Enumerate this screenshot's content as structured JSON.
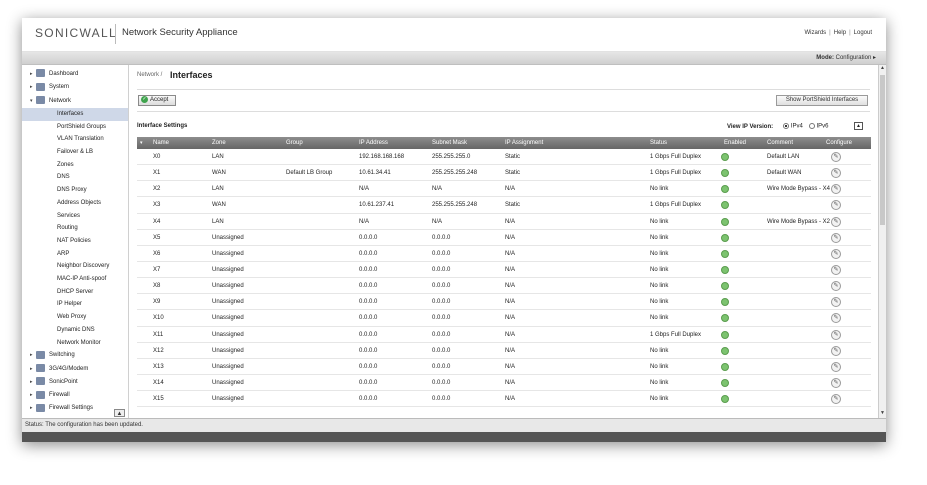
{
  "header": {
    "logo": "SONICWALL",
    "app_name": "Network Security Appliance",
    "links": [
      "Wizards",
      "Help",
      "Logout"
    ]
  },
  "modebar": {
    "mode_label": "Mode:",
    "mode_value": "Configuration ▸"
  },
  "sidebar": {
    "top_items": [
      {
        "label": "Dashboard",
        "arrow": "▸"
      },
      {
        "label": "System",
        "arrow": "▸"
      },
      {
        "label": "Network",
        "arrow": "▾"
      }
    ],
    "network_items": [
      "Interfaces",
      "PortShield Groups",
      "VLAN Translation",
      "Failover & LB",
      "Zones",
      "DNS",
      "DNS Proxy",
      "Address Objects",
      "Services",
      "Routing",
      "NAT Policies",
      "ARP",
      "Neighbor Discovery",
      "MAC-IP Anti-spoof",
      "DHCP Server",
      "IP Helper",
      "Web Proxy",
      "Dynamic DNS",
      "Network Monitor"
    ],
    "bottom_items": [
      {
        "label": "Switching",
        "arrow": "▸"
      },
      {
        "label": "3G/4G/Modem",
        "arrow": "▸"
      },
      {
        "label": "SonicPoint",
        "arrow": "▸"
      },
      {
        "label": "Firewall",
        "arrow": "▸"
      },
      {
        "label": "Firewall Settings",
        "arrow": "▸"
      }
    ]
  },
  "main": {
    "breadcrumb": "Network /",
    "title": "Interfaces",
    "accept_label": "Accept",
    "portshield_label": "Show PortShield Interfaces",
    "settings_title": "Interface Settings",
    "ip_version_label": "View IP Version:",
    "ipv4_label": "IPv4",
    "ipv6_label": "IPv6"
  },
  "table": {
    "columns": [
      "Name",
      "Zone",
      "Group",
      "IP Address",
      "Subnet Mask",
      "IP Assignment",
      "Status",
      "Enabled",
      "Comment",
      "Configure"
    ],
    "rows": [
      {
        "name": "X0",
        "zone": "LAN",
        "group": "",
        "ip": "192.168.168.168",
        "mask": "255.255.255.0",
        "assign": "Static",
        "status": "1 Gbps Full Duplex",
        "comment": "Default LAN"
      },
      {
        "name": "X1",
        "zone": "WAN",
        "group": "Default LB Group",
        "ip": "10.61.34.41",
        "mask": "255.255.255.248",
        "assign": "Static",
        "status": "1 Gbps Full Duplex",
        "comment": "Default WAN"
      },
      {
        "name": "X2",
        "zone": "LAN",
        "group": "",
        "ip": "N/A",
        "mask": "N/A",
        "assign": "N/A",
        "status": "No link",
        "comment": "Wire Mode Bypass - X4"
      },
      {
        "name": "X3",
        "zone": "WAN",
        "group": "",
        "ip": "10.61.237.41",
        "mask": "255.255.255.248",
        "assign": "Static",
        "status": "1 Gbps Full Duplex",
        "comment": ""
      },
      {
        "name": "X4",
        "zone": "LAN",
        "group": "",
        "ip": "N/A",
        "mask": "N/A",
        "assign": "N/A",
        "status": "No link",
        "comment": "Wire Mode Bypass - X2"
      },
      {
        "name": "X5",
        "zone": "Unassigned",
        "group": "",
        "ip": "0.0.0.0",
        "mask": "0.0.0.0",
        "assign": "N/A",
        "status": "No link",
        "comment": ""
      },
      {
        "name": "X6",
        "zone": "Unassigned",
        "group": "",
        "ip": "0.0.0.0",
        "mask": "0.0.0.0",
        "assign": "N/A",
        "status": "No link",
        "comment": ""
      },
      {
        "name": "X7",
        "zone": "Unassigned",
        "group": "",
        "ip": "0.0.0.0",
        "mask": "0.0.0.0",
        "assign": "N/A",
        "status": "No link",
        "comment": ""
      },
      {
        "name": "X8",
        "zone": "Unassigned",
        "group": "",
        "ip": "0.0.0.0",
        "mask": "0.0.0.0",
        "assign": "N/A",
        "status": "No link",
        "comment": ""
      },
      {
        "name": "X9",
        "zone": "Unassigned",
        "group": "",
        "ip": "0.0.0.0",
        "mask": "0.0.0.0",
        "assign": "N/A",
        "status": "No link",
        "comment": ""
      },
      {
        "name": "X10",
        "zone": "Unassigned",
        "group": "",
        "ip": "0.0.0.0",
        "mask": "0.0.0.0",
        "assign": "N/A",
        "status": "No link",
        "comment": ""
      },
      {
        "name": "X11",
        "zone": "Unassigned",
        "group": "",
        "ip": "0.0.0.0",
        "mask": "0.0.0.0",
        "assign": "N/A",
        "status": "1 Gbps Full Duplex",
        "comment": ""
      },
      {
        "name": "X12",
        "zone": "Unassigned",
        "group": "",
        "ip": "0.0.0.0",
        "mask": "0.0.0.0",
        "assign": "N/A",
        "status": "No link",
        "comment": ""
      },
      {
        "name": "X13",
        "zone": "Unassigned",
        "group": "",
        "ip": "0.0.0.0",
        "mask": "0.0.0.0",
        "assign": "N/A",
        "status": "No link",
        "comment": ""
      },
      {
        "name": "X14",
        "zone": "Unassigned",
        "group": "",
        "ip": "0.0.0.0",
        "mask": "0.0.0.0",
        "assign": "N/A",
        "status": "No link",
        "comment": ""
      },
      {
        "name": "X15",
        "zone": "Unassigned",
        "group": "",
        "ip": "0.0.0.0",
        "mask": "0.0.0.0",
        "assign": "N/A",
        "status": "No link",
        "comment": ""
      }
    ]
  },
  "statusbar": {
    "text": "Status: The configuration has been updated."
  },
  "colors": {
    "accent": "#cfd8e8",
    "enabled_ok": "#7cc36f",
    "header_bar": "#777777"
  }
}
